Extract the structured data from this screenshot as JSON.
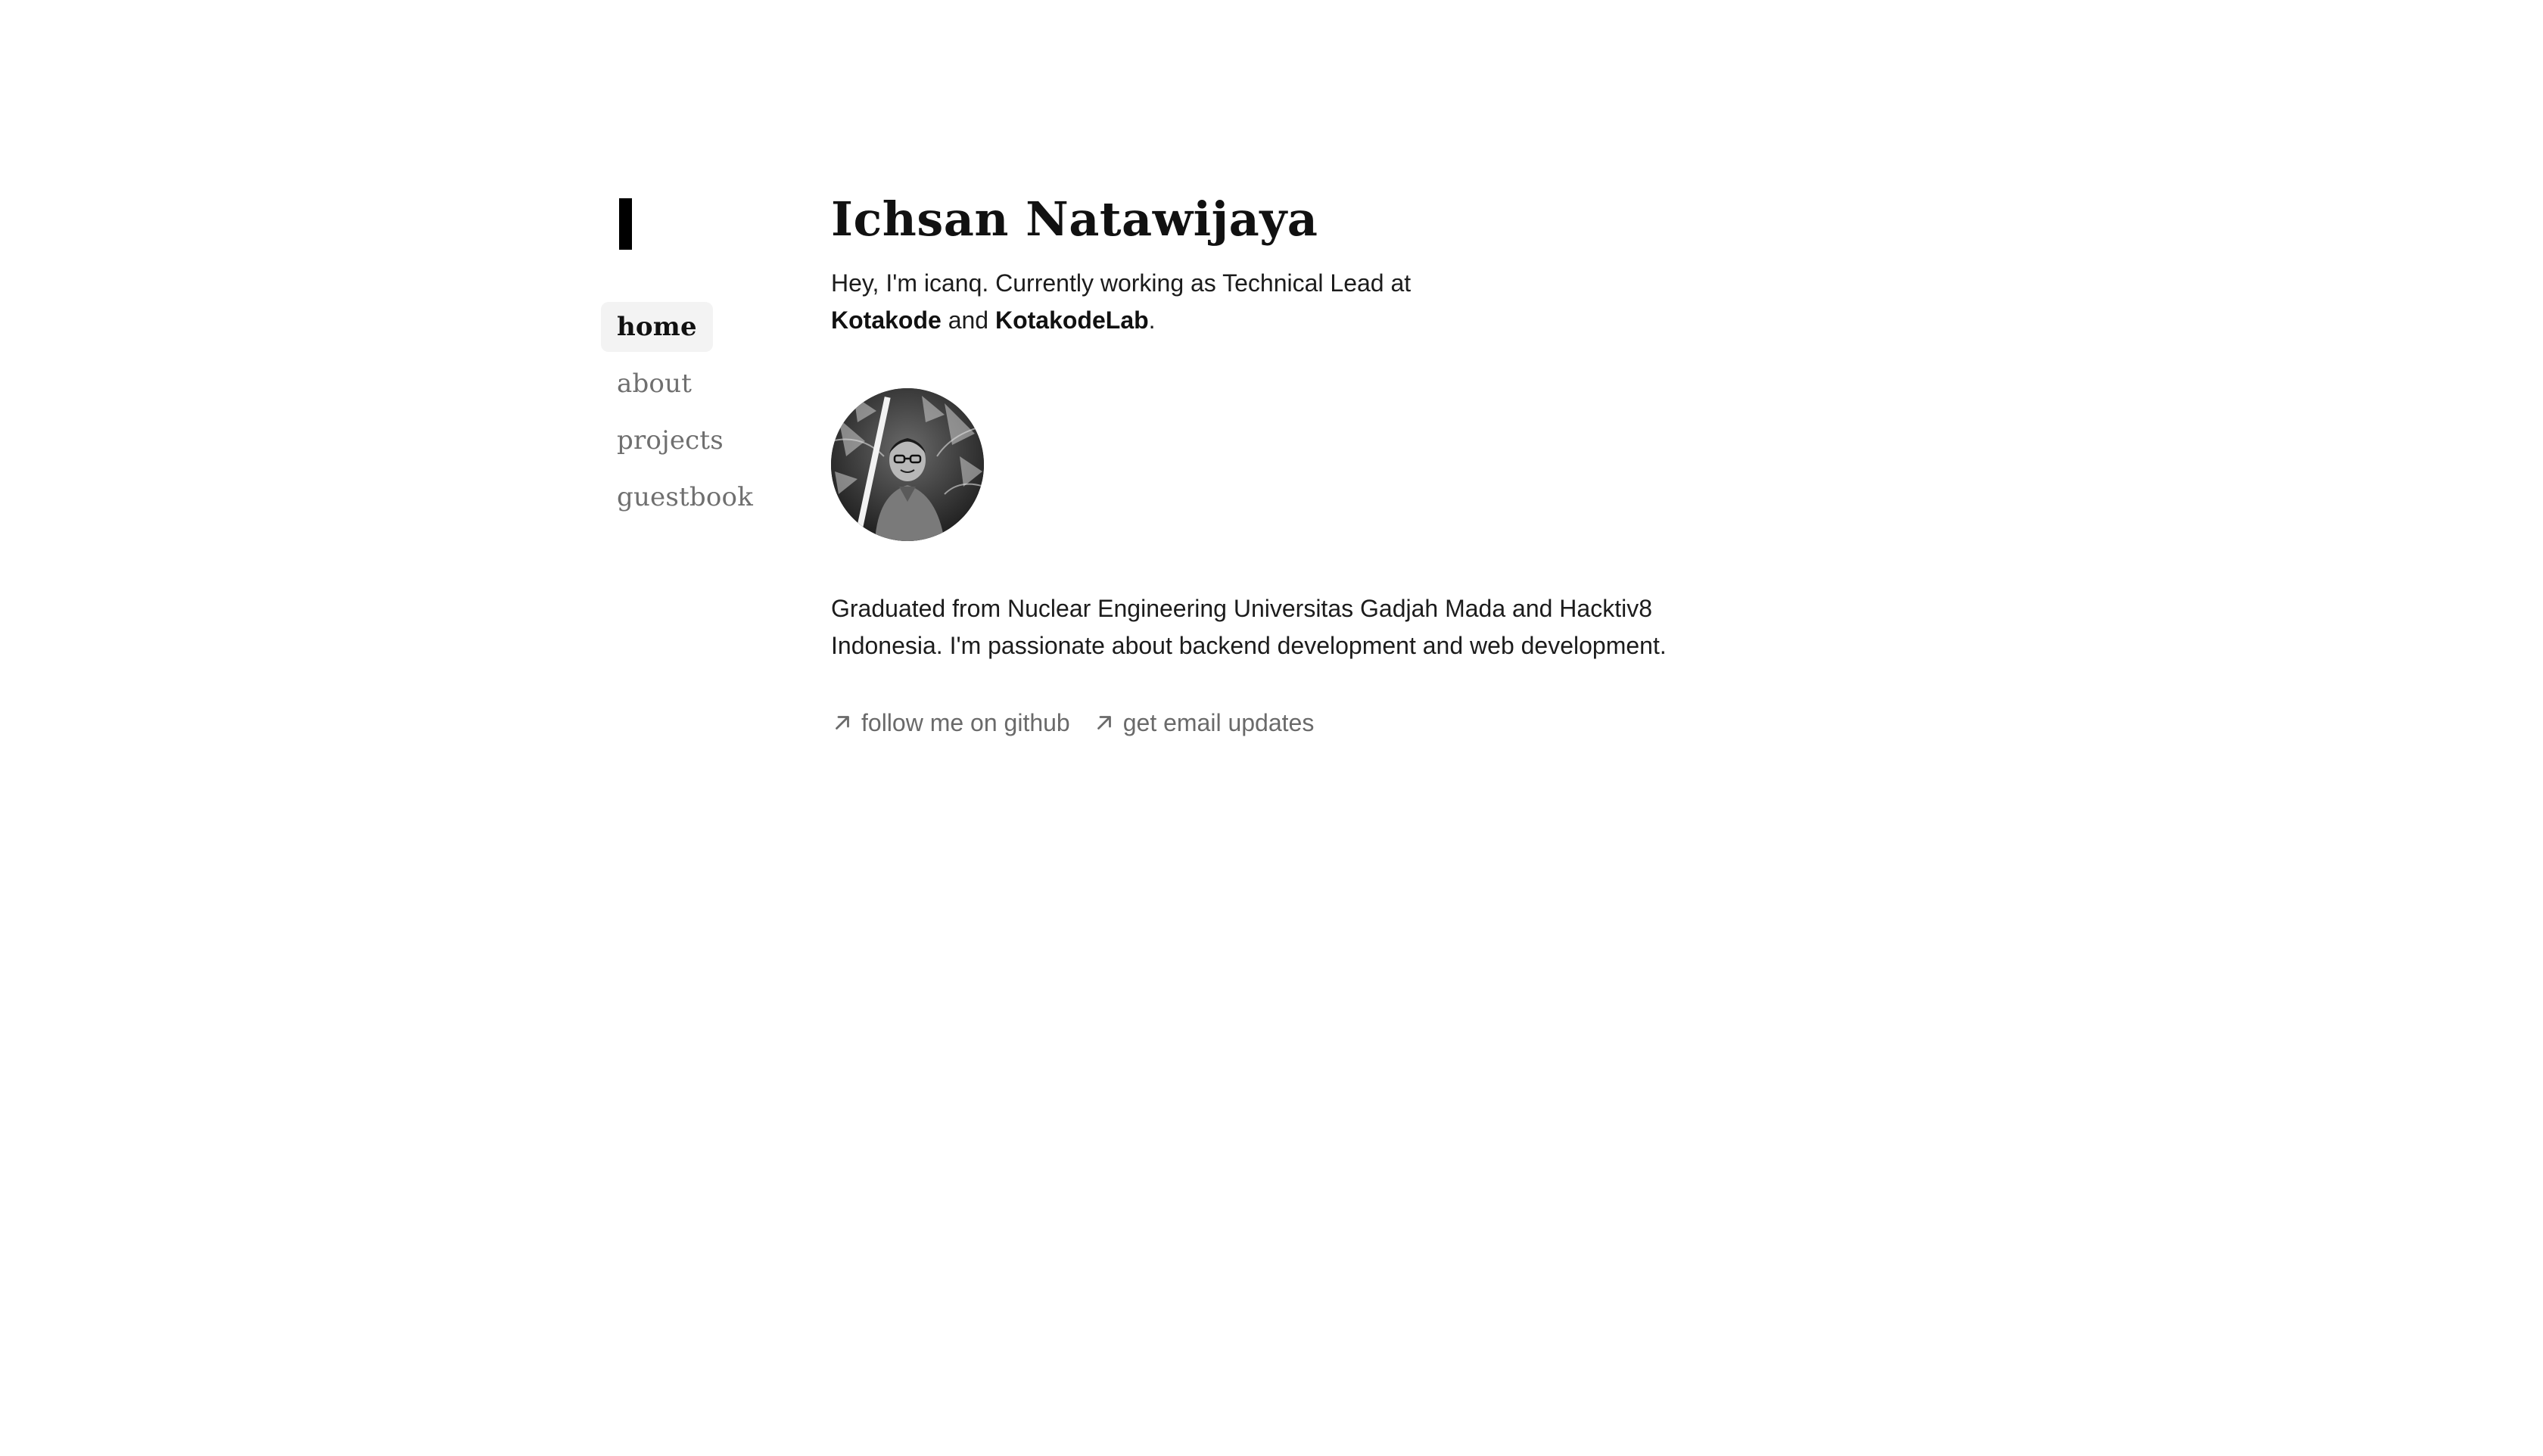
{
  "nav": {
    "items": [
      {
        "label": "home",
        "active": true
      },
      {
        "label": "about",
        "active": false
      },
      {
        "label": "projects",
        "active": false
      },
      {
        "label": "guestbook",
        "active": false
      }
    ]
  },
  "main": {
    "title": "Ichsan Natawijaya",
    "intro": {
      "prefix": "Hey, I'm icanq. Currently working as Technical Lead at",
      "company1": "Kotakode",
      "conj": "and",
      "company2": "KotakodeLab",
      "suffix": "."
    },
    "bio": "Graduated from Nuclear Engineering Universitas Gadjah Mada and Hacktiv8 Indonesia. I'm passionate about backend development and web development.",
    "links": [
      {
        "label": "follow me on github",
        "icon": "arrow-up-right-icon"
      },
      {
        "label": "get email updates",
        "icon": "arrow-up-right-icon"
      }
    ]
  },
  "colors": {
    "text": "#111111",
    "muted": "#6f6f6f",
    "active_bg": "#f3f3f3"
  }
}
